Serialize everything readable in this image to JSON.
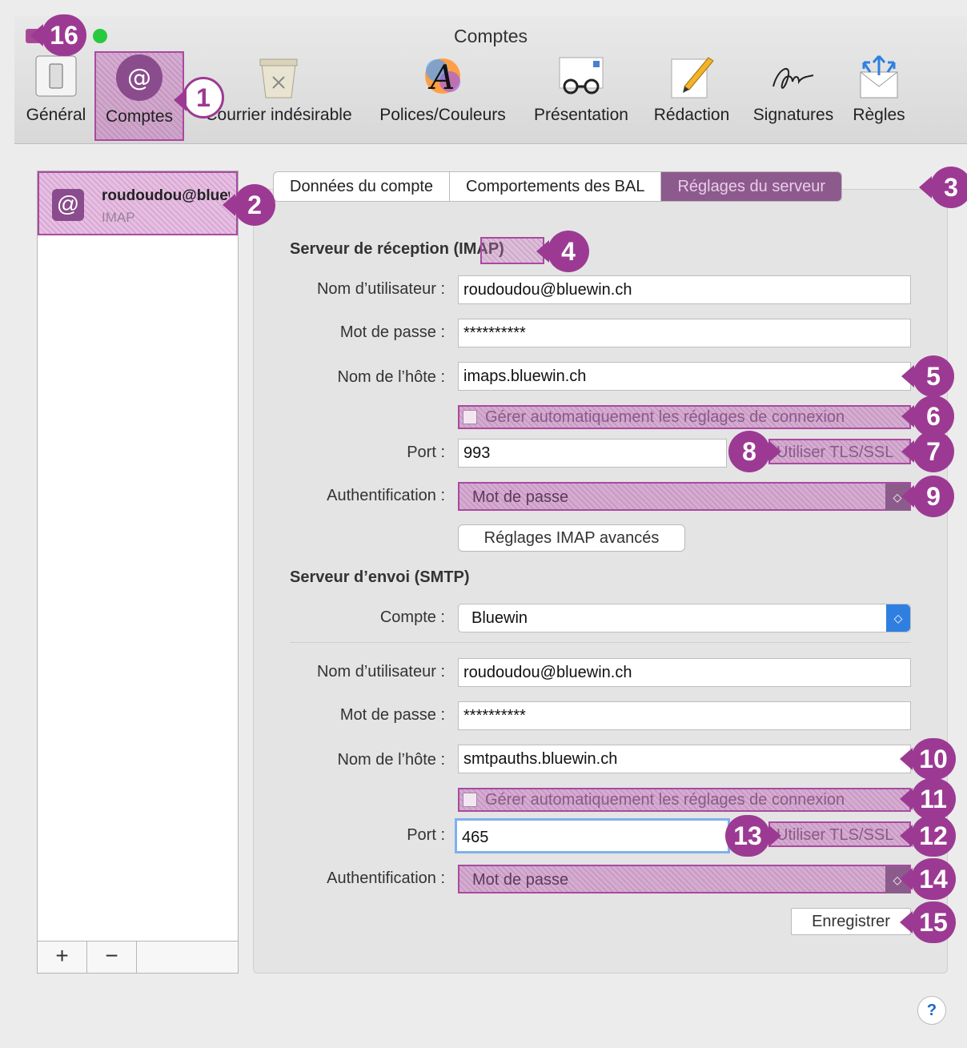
{
  "window": {
    "title": "Comptes"
  },
  "toolbar": {
    "items": [
      {
        "label": "Général"
      },
      {
        "label": "Comptes"
      },
      {
        "label": "Courrier indésirable"
      },
      {
        "label": "Polices/Couleurs"
      },
      {
        "label": "Présentation"
      },
      {
        "label": "Rédaction"
      },
      {
        "label": "Signatures"
      },
      {
        "label": "Règles"
      }
    ]
  },
  "accounts": {
    "items": [
      {
        "name": "roudoudou@bluewin.ch",
        "type": "IMAP",
        "icon": "at-icon"
      }
    ],
    "add_label": "+",
    "remove_label": "−"
  },
  "tabs": [
    {
      "label": "Données du compte"
    },
    {
      "label": "Comportements des BAL"
    },
    {
      "label": "Réglages du serveur",
      "active": true
    }
  ],
  "incoming": {
    "title": "Serveur de réception (IMAP)",
    "username_label": "Nom d’utilisateur :",
    "username": "roudoudou@bluewin.ch",
    "password_label": "Mot de passe :",
    "password": "**********",
    "host_label": "Nom de l’hôte :",
    "host": "imaps.bluewin.ch",
    "auto_manage": "Gérer automatiquement les réglages de connexion",
    "port_label": "Port :",
    "port": "993",
    "tls": "Utiliser TLS/SSL",
    "auth_label": "Authentification :",
    "auth": "Mot de passe",
    "advanced_button": "Réglages IMAP avancés"
  },
  "outgoing": {
    "title": "Serveur d’envoi (SMTP)",
    "account_label": "Compte :",
    "account": "Bluewin",
    "username_label": "Nom d’utilisateur :",
    "username": "roudoudou@bluewin.ch",
    "password_label": "Mot de passe :",
    "password": "**********",
    "host_label": "Nom de l’hôte :",
    "host": "smtpauths.bluewin.ch",
    "auto_manage": "Gérer automatiquement les réglages de connexion",
    "port_label": "Port :",
    "port": "465",
    "tls": "Utiliser TLS/SSL",
    "auth_label": "Authentification :",
    "auth": "Mot de passe"
  },
  "save_button": "Enregistrer",
  "help": "?",
  "badges": [
    "1",
    "2",
    "3",
    "4",
    "5",
    "6",
    "7",
    "8",
    "9",
    "10",
    "11",
    "12",
    "13",
    "14",
    "15",
    "16"
  ],
  "colors": {
    "highlight": "#9c3a93",
    "selected_tab": "#8d5a8e"
  }
}
